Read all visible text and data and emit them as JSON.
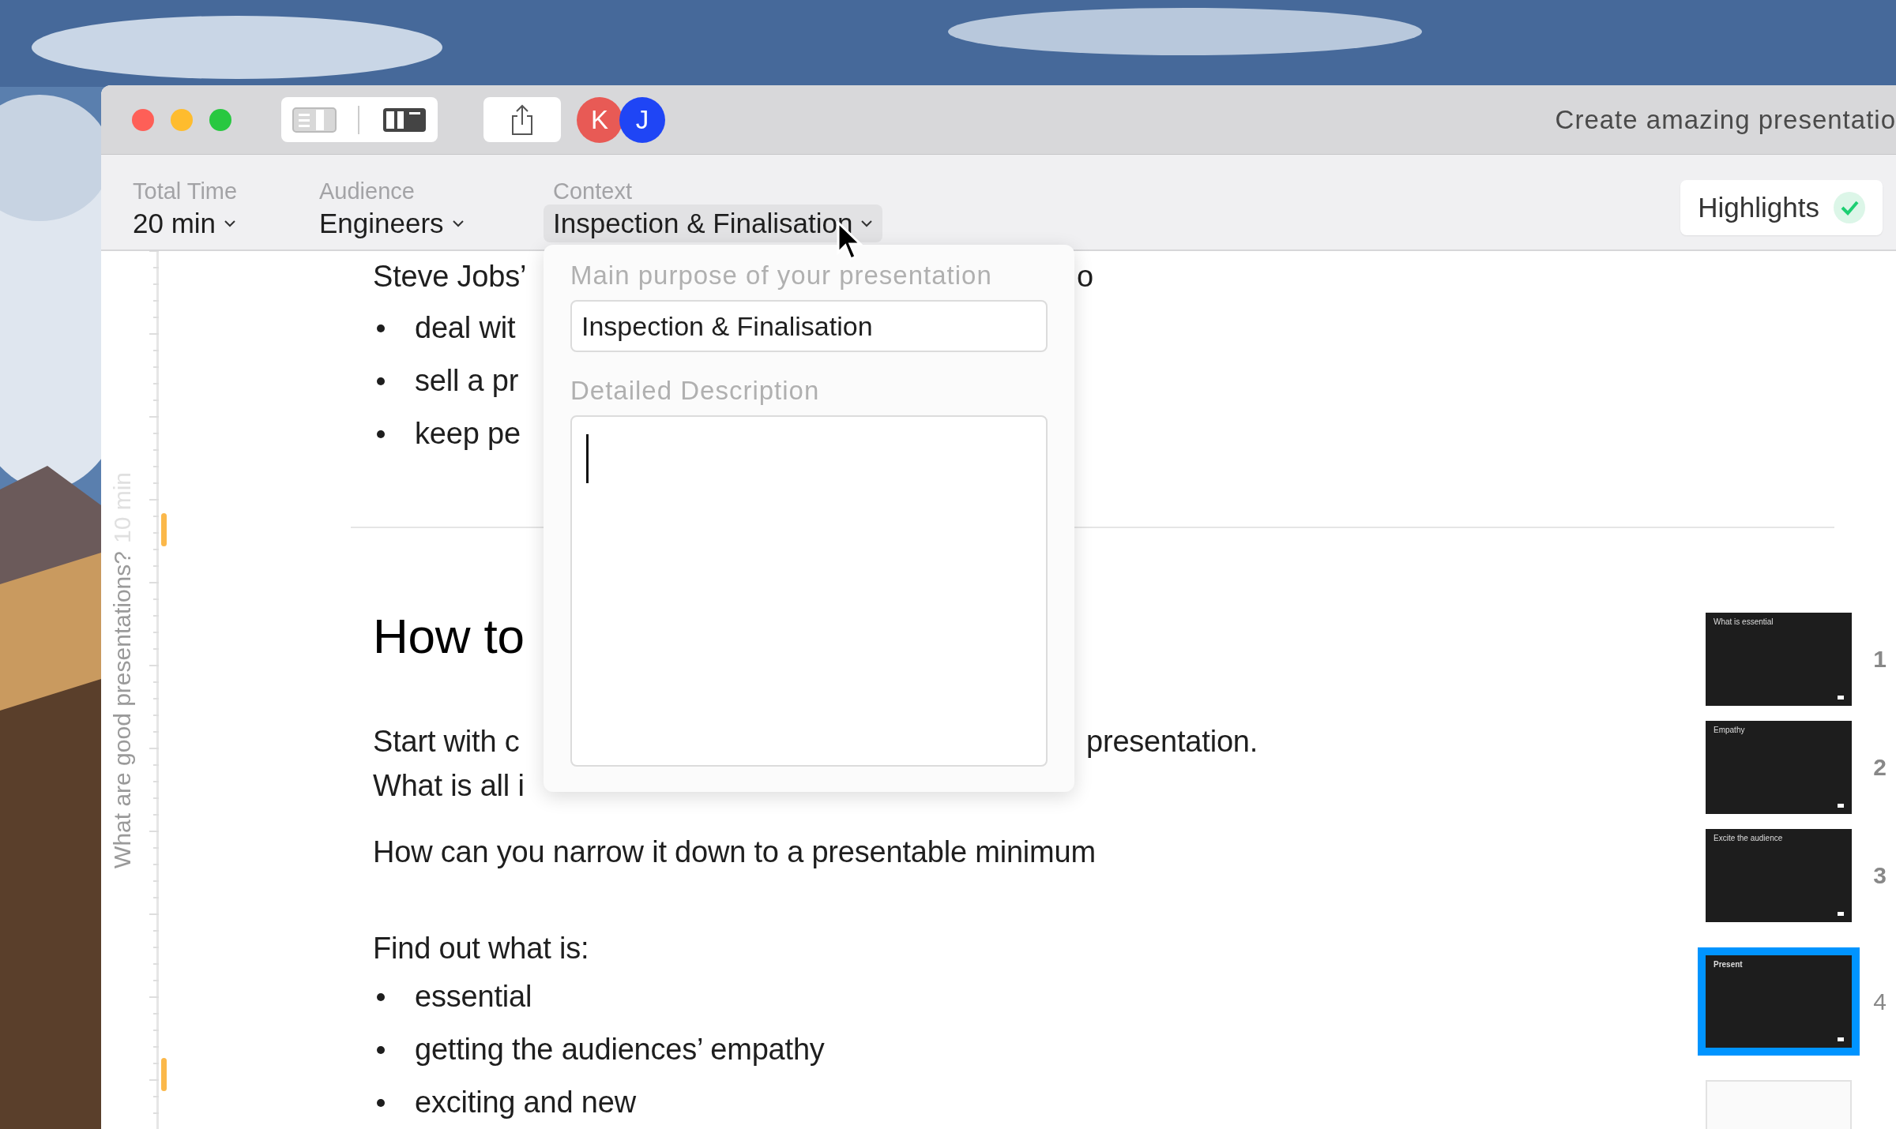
{
  "window": {
    "title": "Create amazing presentatio",
    "collaborators": [
      {
        "initial": "K",
        "color": "#e85a55"
      },
      {
        "initial": "J",
        "color": "#1f45f5"
      }
    ]
  },
  "toolbar": {
    "fields": [
      {
        "label": "Total Time",
        "value": "20 min",
        "selected": false
      },
      {
        "label": "Audience",
        "value": "Engineers",
        "selected": false
      },
      {
        "label": "Context",
        "value": "Inspection & Finalisation",
        "selected": true
      }
    ],
    "highlights": {
      "label": "Highlights",
      "checked": true
    }
  },
  "ruler": {
    "time_label": "10 min",
    "section_title": "What are good presentations?"
  },
  "document": {
    "blocks": [
      {
        "kind": "para",
        "text": "Steve Jobs’",
        "right_text": "o"
      },
      {
        "kind": "bullet",
        "text": "deal wit"
      },
      {
        "kind": "bullet",
        "text": "sell a pr"
      },
      {
        "kind": "bullet",
        "text": "keep pe"
      },
      {
        "kind": "rule"
      },
      {
        "kind": "heading",
        "text": "How to"
      },
      {
        "kind": "para",
        "text": "Start with c",
        "right_text": "presentation."
      },
      {
        "kind": "para",
        "text": "What is all i"
      },
      {
        "kind": "para",
        "text": "How can you narrow it down to a presentable minimum"
      },
      {
        "kind": "para",
        "text": "Find out what is:"
      },
      {
        "kind": "bullet",
        "text": "essential"
      },
      {
        "kind": "bullet",
        "text": "getting the audiences’ empathy"
      },
      {
        "kind": "bullet",
        "text": "exciting and new"
      }
    ]
  },
  "popover": {
    "purpose_label": "Main purpose of your presentation",
    "purpose_value": "Inspection & Finalisation",
    "description_label": "Detailed Description"
  },
  "slides": [
    {
      "title": "What is essential",
      "number": "1",
      "selected": false
    },
    {
      "title": "Empathy",
      "number": "2",
      "selected": false
    },
    {
      "title": "Excite the audience",
      "number": "3",
      "selected": false
    },
    {
      "title": "Present",
      "number": "4",
      "selected": true
    },
    {
      "selected": false
    }
  ]
}
